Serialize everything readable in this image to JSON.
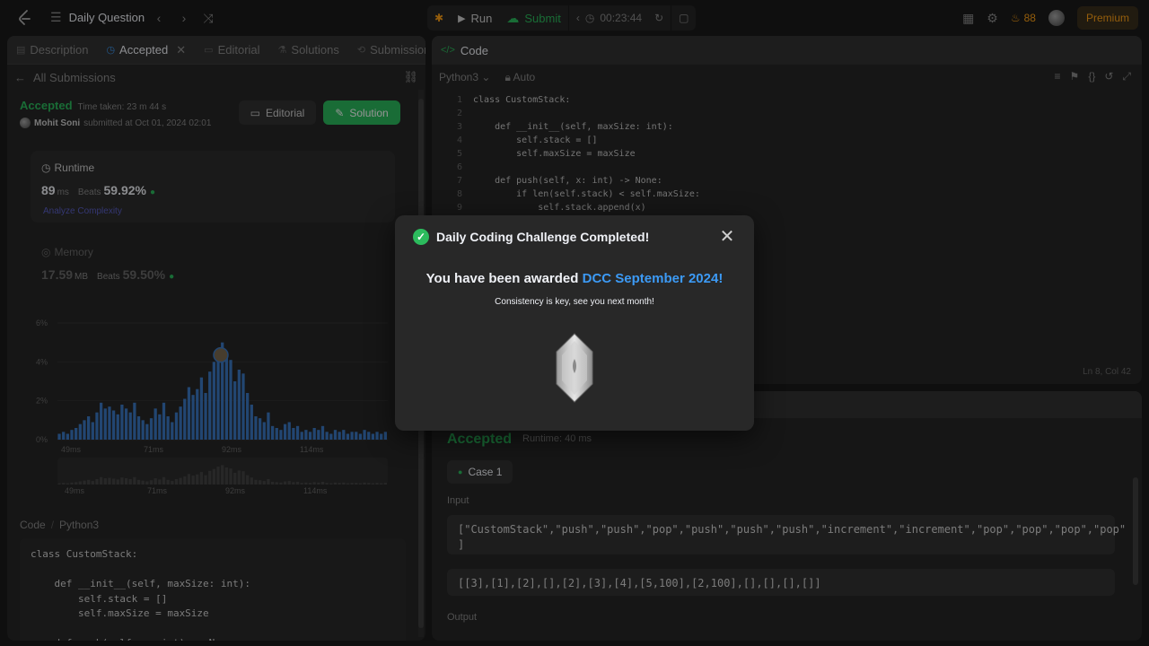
{
  "topbar": {
    "title": "Daily Question",
    "run_label": "Run",
    "submit_label": "Submit",
    "timer": "00:23:44",
    "streak": "88",
    "premium_label": "Premium"
  },
  "left": {
    "tabs": [
      {
        "label": "Description",
        "icon": "description-icon"
      },
      {
        "label": "Accepted",
        "icon": "clock-icon"
      },
      {
        "label": "Editorial",
        "icon": "book-icon"
      },
      {
        "label": "Solutions",
        "icon": "flask-icon"
      },
      {
        "label": "Submissions",
        "icon": "history-icon"
      }
    ],
    "back_label": "All Submissions",
    "status": "Accepted",
    "time_taken": "Time taken: 23 m 44 s",
    "user": "Mohit Soni",
    "submitted_at": "submitted at Oct 01, 2024 02:01",
    "editorial_btn": "Editorial",
    "solution_btn": "Solution",
    "runtime": {
      "title": "Runtime",
      "value": "89",
      "unit": "ms",
      "beats_label": "Beats",
      "beats": "59.92%",
      "analyze": "Analyze Complexity"
    },
    "memory": {
      "title": "Memory",
      "value": "17.59",
      "unit": "MB",
      "beats_label": "Beats",
      "beats": "59.50%"
    },
    "code_label": "Code",
    "code_lang": "Python3",
    "code_lines": [
      "class CustomStack:",
      "",
      "    def __init__(self, maxSize: int):",
      "        self.stack = []",
      "        self.maxSize = maxSize",
      "",
      "    def push(self, x: int) -> None:"
    ]
  },
  "chart_data": {
    "type": "bar",
    "title": "",
    "xlabel": "",
    "ylabel": "",
    "ylim": [
      0,
      6
    ],
    "y_ticks": [
      "0%",
      "2%",
      "4%",
      "6%"
    ],
    "x_ticks": [
      "49ms",
      "71ms",
      "92ms",
      "114ms"
    ],
    "minimap_ticks": [
      "49ms",
      "71ms",
      "92ms",
      "114ms"
    ],
    "values": [
      0.3,
      0.4,
      0.3,
      0.5,
      0.6,
      0.8,
      1.0,
      1.2,
      0.9,
      1.4,
      1.9,
      1.6,
      1.7,
      1.5,
      1.3,
      1.8,
      1.6,
      1.4,
      1.9,
      1.2,
      1.0,
      0.8,
      1.1,
      1.6,
      1.3,
      1.9,
      1.2,
      0.9,
      1.4,
      1.7,
      2.1,
      2.7,
      2.3,
      2.6,
      3.2,
      2.4,
      3.5,
      4.0,
      4.6,
      5.0,
      4.4,
      4.1,
      3.0,
      3.6,
      3.4,
      2.4,
      1.8,
      1.2,
      1.1,
      0.9,
      1.4,
      0.7,
      0.6,
      0.5,
      0.8,
      0.9,
      0.6,
      0.7,
      0.4,
      0.5,
      0.4,
      0.6,
      0.5,
      0.7,
      0.4,
      0.3,
      0.5,
      0.4,
      0.5,
      0.3,
      0.4,
      0.4,
      0.3,
      0.5,
      0.4,
      0.3,
      0.4,
      0.3,
      0.4
    ],
    "highlight_value": "89ms",
    "grid": true,
    "bar_color": "#3c79c5"
  },
  "editor": {
    "tab_label": "Code",
    "language": "Python3",
    "mode": "Auto",
    "cursor": "Ln 8, Col 42",
    "lines": [
      "class CustomStack:",
      "",
      "    def __init__(self, maxSize: int):",
      "        self.stack = []",
      "        self.maxSize = maxSize",
      "",
      "    def push(self, x: int) -> None:",
      "        if len(self.stack) < self.maxSize:",
      "            self.stack.append(x)"
    ]
  },
  "result": {
    "status": "Accepted",
    "runtime": "Runtime: 40 ms",
    "case_label": "Case 1",
    "input_label": "Input",
    "input_line1": "[\"CustomStack\",\"push\",\"push\",\"pop\",\"push\",\"push\",\"push\",\"increment\",\"increment\",\"pop\",\"pop\",\"pop\",\"pop\"",
    "input_line1b": "]",
    "input_line2": "[[3],[1],[2],[],[2],[3],[4],[5,100],[2,100],[],[],[],[]]",
    "output_label": "Output"
  },
  "modal": {
    "title": "Daily Coding Challenge Completed!",
    "award_prefix": "You have been awarded ",
    "award_name": "DCC September 2024!",
    "subtitle": "Consistency is key, see you next month!"
  },
  "colors": {
    "accent_green": "#2cbb5d",
    "accent_blue": "#3c9af5",
    "accent_orange": "#ffa116"
  }
}
